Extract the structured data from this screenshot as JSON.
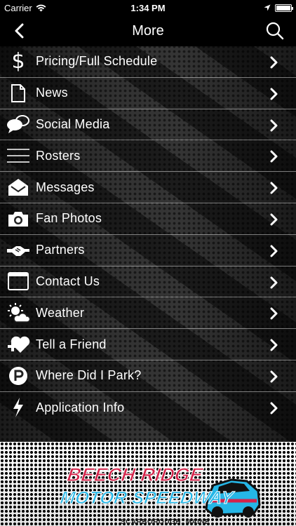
{
  "status_bar": {
    "carrier": "Carrier",
    "time": "1:34 PM"
  },
  "nav": {
    "title": "More"
  },
  "menu": {
    "items": [
      {
        "label": "Pricing/Full Schedule",
        "icon": "dollar-icon"
      },
      {
        "label": "News",
        "icon": "document-icon"
      },
      {
        "label": "Social Media",
        "icon": "chat-bubbles-icon"
      },
      {
        "label": "Rosters",
        "icon": "list-lines-icon"
      },
      {
        "label": "Messages",
        "icon": "envelope-icon"
      },
      {
        "label": "Fan Photos",
        "icon": "camera-icon"
      },
      {
        "label": "Partners",
        "icon": "handshake-icon"
      },
      {
        "label": "Contact Us",
        "icon": "browser-window-icon"
      },
      {
        "label": "Weather",
        "icon": "sun-cloud-icon"
      },
      {
        "label": "Tell a Friend",
        "icon": "heart-plus-icon"
      },
      {
        "label": "Where Did I Park?",
        "icon": "parking-icon"
      },
      {
        "label": "Application Info",
        "icon": "lightning-icon"
      }
    ]
  },
  "logo": {
    "line1": "BEECH RIDGE",
    "line2": "MOTOR SPEEDWAY",
    "line3": "SCARBOROUGH, MAINE"
  },
  "colors": {
    "logo_red": "#d3244b",
    "logo_blue": "#25b6e6"
  }
}
